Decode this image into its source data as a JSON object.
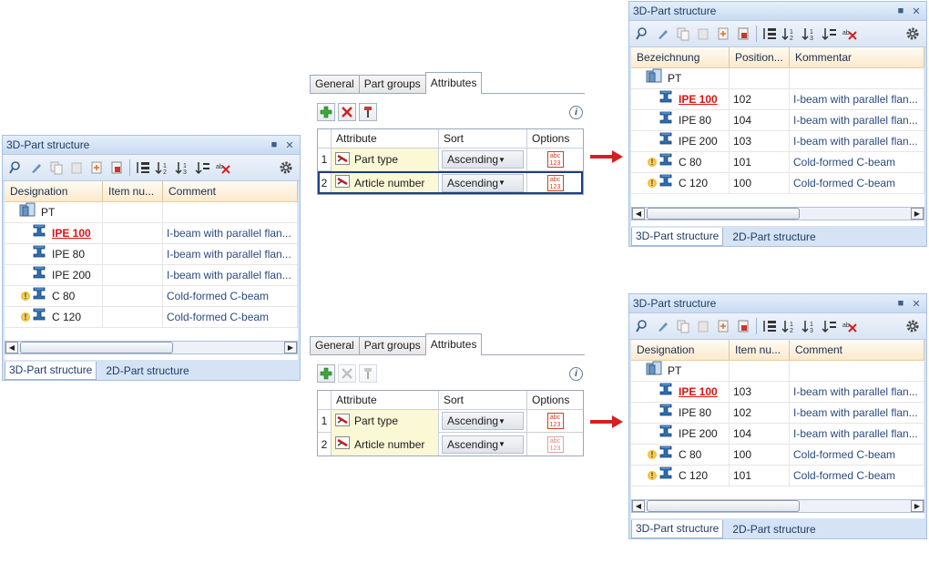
{
  "left_panel": {
    "title": "3D-Part structure",
    "columns": [
      "Designation",
      "Item nu...",
      "Comment"
    ],
    "rows": [
      {
        "name": "PT",
        "item": "",
        "comment": "",
        "icon": "assembly-icon",
        "warn": false,
        "highlight": false
      },
      {
        "name": "IPE 100",
        "item": "",
        "comment": "I-beam with parallel flan...",
        "icon": "beam-icon",
        "warn": false,
        "highlight": true
      },
      {
        "name": "IPE 80",
        "item": "",
        "comment": "I-beam with parallel flan...",
        "icon": "beam-icon",
        "warn": false,
        "highlight": false
      },
      {
        "name": "IPE 200",
        "item": "",
        "comment": "I-beam with parallel flan...",
        "icon": "beam-icon",
        "warn": false,
        "highlight": false
      },
      {
        "name": "C 80",
        "item": "",
        "comment": "Cold-formed C-beam",
        "icon": "beam-icon",
        "warn": true,
        "highlight": false
      },
      {
        "name": "C 120",
        "item": "",
        "comment": "Cold-formed C-beam",
        "icon": "beam-icon",
        "warn": true,
        "highlight": false
      }
    ],
    "tabs": [
      "3D-Part structure",
      "2D-Part structure"
    ]
  },
  "dialog_top": {
    "tabs": [
      "General",
      "Part groups",
      "Attributes"
    ],
    "active_tab": "Attributes",
    "columns": [
      "Attribute",
      "Sort",
      "Options"
    ],
    "rows": [
      {
        "num": "1",
        "attribute": "Part type",
        "sort": "Ascending"
      },
      {
        "num": "2",
        "attribute": "Article number",
        "sort": "Ascending"
      }
    ]
  },
  "dialog_bottom": {
    "tabs": [
      "General",
      "Part groups",
      "Attributes"
    ],
    "active_tab": "Attributes",
    "columns": [
      "Attribute",
      "Sort",
      "Options"
    ],
    "rows": [
      {
        "num": "1",
        "attribute": "Part type",
        "sort": "Ascending"
      },
      {
        "num": "2",
        "attribute": "Article number",
        "sort": "Ascending"
      }
    ]
  },
  "right_top_panel": {
    "title": "3D-Part structure",
    "columns": [
      "Bezeichnung",
      "Position...",
      "Kommentar"
    ],
    "rows": [
      {
        "name": "PT",
        "item": "",
        "comment": "",
        "icon": "assembly-icon",
        "warn": false,
        "highlight": false
      },
      {
        "name": "IPE 100",
        "item": "102",
        "comment": "I-beam with parallel flan...",
        "icon": "beam-icon",
        "warn": false,
        "highlight": true
      },
      {
        "name": "IPE 80",
        "item": "104",
        "comment": "I-beam with parallel flan...",
        "icon": "beam-icon",
        "warn": false,
        "highlight": false
      },
      {
        "name": "IPE 200",
        "item": "103",
        "comment": "I-beam with parallel flan...",
        "icon": "beam-icon",
        "warn": false,
        "highlight": false
      },
      {
        "name": "C 80",
        "item": "101",
        "comment": "Cold-formed C-beam",
        "icon": "beam-icon",
        "warn": true,
        "highlight": false
      },
      {
        "name": "C 120",
        "item": "100",
        "comment": "Cold-formed C-beam",
        "icon": "beam-icon",
        "warn": true,
        "highlight": false
      }
    ],
    "tabs": [
      "3D-Part structure",
      "2D-Part structure"
    ]
  },
  "right_bottom_panel": {
    "title": "3D-Part structure",
    "columns": [
      "Designation",
      "Item nu...",
      "Comment"
    ],
    "rows": [
      {
        "name": "PT",
        "item": "",
        "comment": "",
        "icon": "assembly-icon",
        "warn": false,
        "highlight": false
      },
      {
        "name": "IPE 100",
        "item": "103",
        "comment": "I-beam with parallel flan...",
        "icon": "beam-icon",
        "warn": false,
        "highlight": true
      },
      {
        "name": "IPE 80",
        "item": "102",
        "comment": "I-beam with parallel flan...",
        "icon": "beam-icon",
        "warn": false,
        "highlight": false
      },
      {
        "name": "IPE 200",
        "item": "104",
        "comment": "I-beam with parallel flan...",
        "icon": "beam-icon",
        "warn": false,
        "highlight": false
      },
      {
        "name": "C 80",
        "item": "100",
        "comment": "Cold-formed C-beam",
        "icon": "beam-icon",
        "warn": true,
        "highlight": false
      },
      {
        "name": "C 120",
        "item": "101",
        "comment": "Cold-formed C-beam",
        "icon": "beam-icon",
        "warn": true,
        "highlight": false
      }
    ],
    "tabs": [
      "3D-Part structure",
      "2D-Part structure"
    ]
  },
  "colors": {
    "accent": "#d11111",
    "link": "#2a4a80",
    "arrow": "#d42020"
  }
}
